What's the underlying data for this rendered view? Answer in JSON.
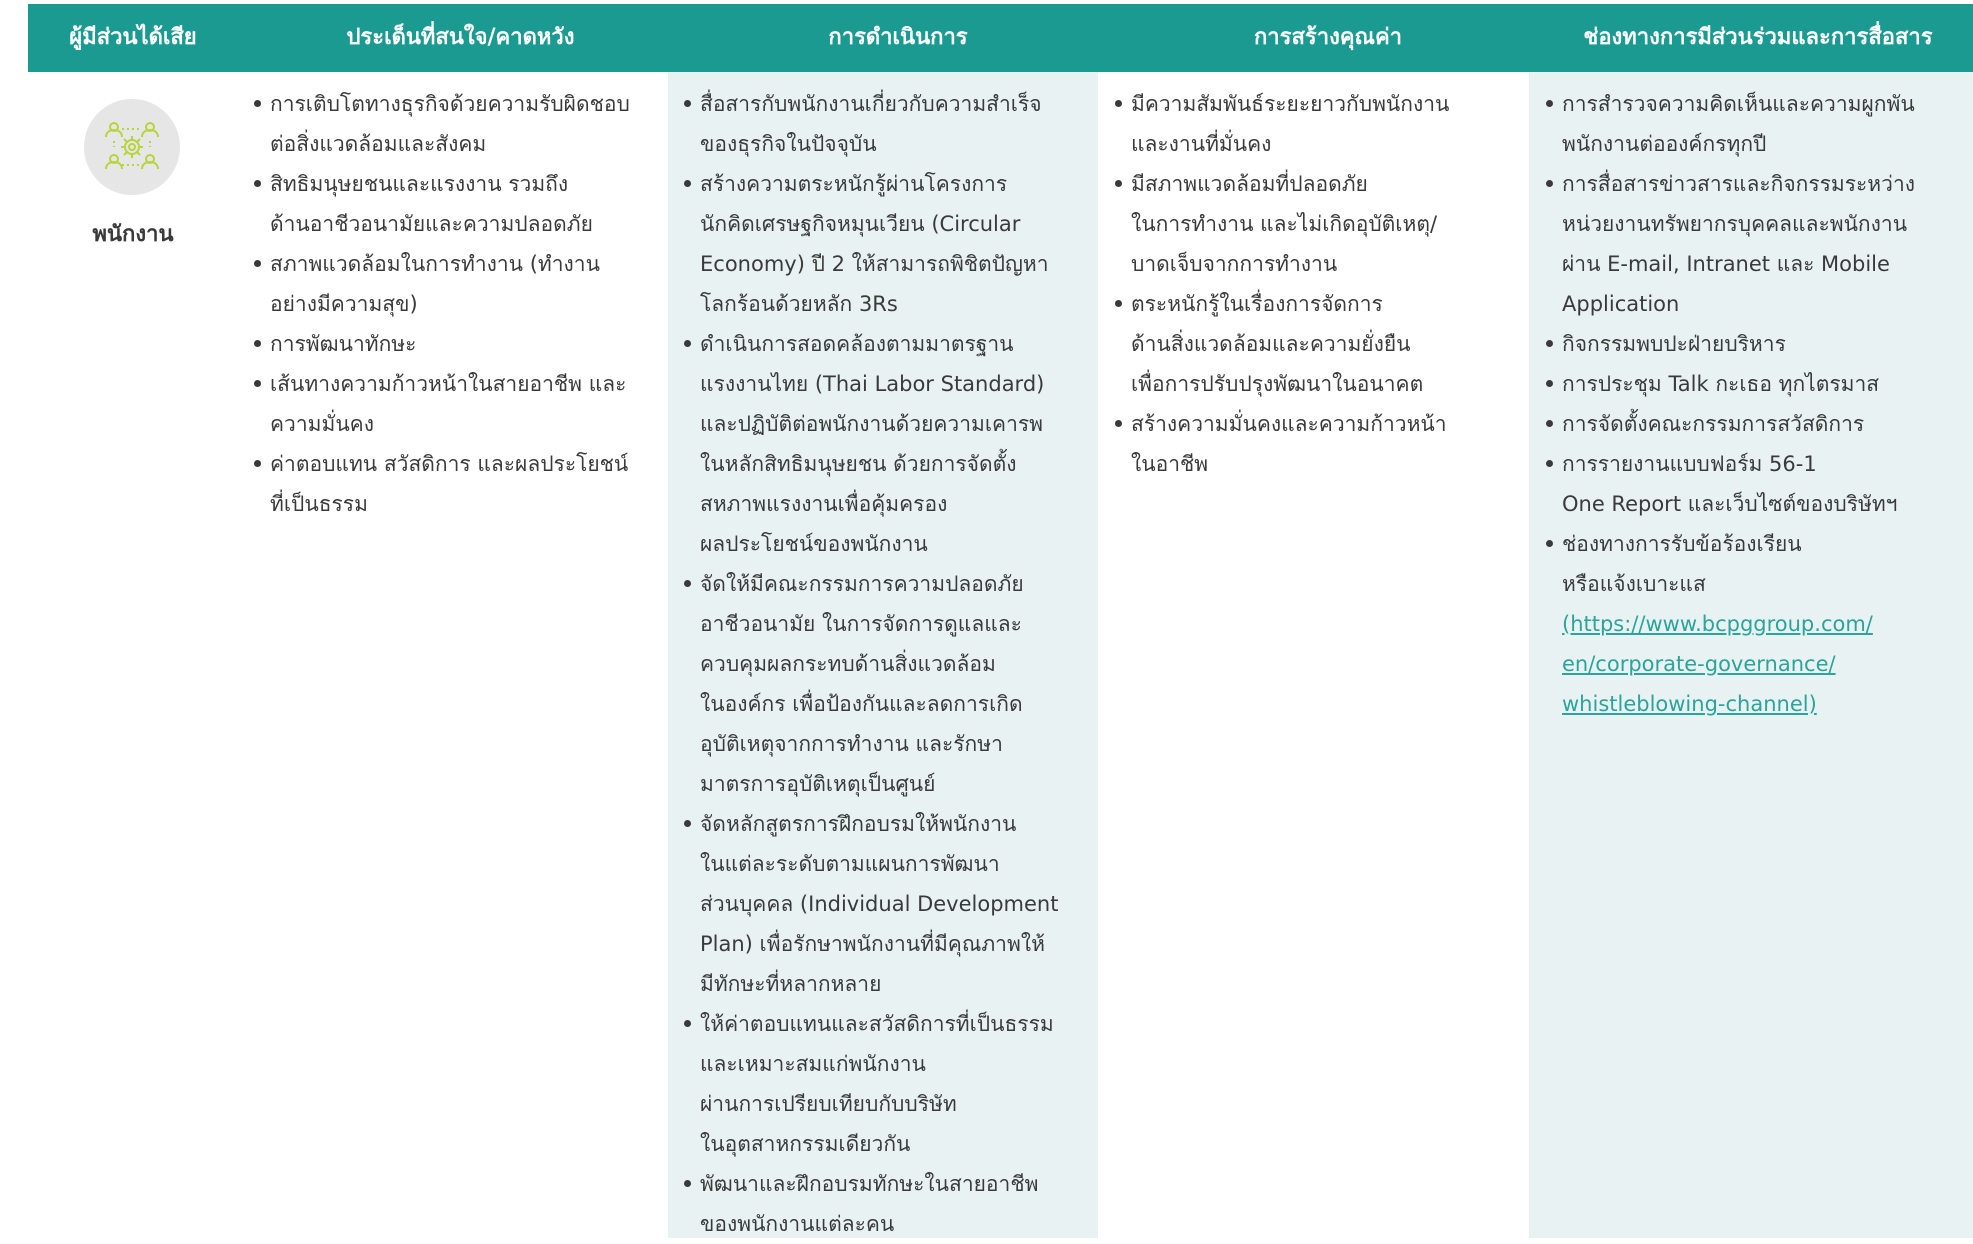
{
  "headers": [
    "ผู้มีส่วนได้เสีย",
    "ประเด็นที่สนใจ/คาดหวัง",
    "การดำเนินการ",
    "การสร้างคุณค่า",
    "ช่องทางการมีส่วนร่วมและการสื่อสาร"
  ],
  "stakeholder": {
    "name": "พนักงาน",
    "icon": "people-network-gear-icon"
  },
  "concerns": [
    [
      "การเติบโตทางธุรกิจด้วยความรับผิดชอบ",
      "ต่อสิ่งแวดล้อมและสังคม"
    ],
    [
      "สิทธิมนุษยชนและแรงงาน รวมถึง",
      "ด้านอาชีวอนามัยและความปลอดภัย"
    ],
    [
      "สภาพแวดล้อมในการทำงาน (ทำงาน",
      "อย่างมีความสุข)"
    ],
    [
      "การพัฒนาทักษะ"
    ],
    [
      "เส้นทางความก้าวหน้าในสายอาชีพ และ",
      "ความมั่นคง"
    ],
    [
      "ค่าตอบแทน สวัสดิการ และผลประโยชน์",
      "ที่เป็นธรรม"
    ]
  ],
  "actions": [
    [
      "สื่อสารกับพนักงานเกี่ยวกับความสำเร็จ",
      "ของธุรกิจในปัจจุบัน"
    ],
    [
      "สร้างความตระหนักรู้ผ่านโครงการ",
      "นักคิดเศรษฐกิจหมุนเวียน (Circular",
      "Economy) ปี 2 ให้สามารถพิชิตปัญหา",
      "โลกร้อนด้วยหลัก 3Rs"
    ],
    [
      "ดำเนินการสอดคล้องตามมาตรฐาน",
      "แรงงานไทย (Thai Labor Standard)",
      "และปฏิบัติต่อพนักงานด้วยความเคารพ",
      "ในหลักสิทธิมนุษยชน ด้วยการจัดตั้ง",
      "สหภาพแรงงานเพื่อคุ้มครอง",
      "ผลประโยชน์ของพนักงาน"
    ],
    [
      "จัดให้มีคณะกรรมการความปลอดภัย",
      "อาชีวอนามัย ในการจัดการดูแลและ",
      "ควบคุมผลกระทบด้านสิ่งแวดล้อม",
      "ในองค์กร เพื่อป้องกันและลดการเกิด",
      "อุบัติเหตุจากการทำงาน และรักษา",
      "มาตรการอุบัติเหตุเป็นศูนย์"
    ],
    [
      "จัดหลักสูตรการฝึกอบรมให้พนักงาน",
      "ในแต่ละระดับตามแผนการพัฒนา",
      "ส่วนบุคคล (Individual Development",
      "Plan) เพื่อรักษาพนักงานที่มีคุณภาพให้",
      "มีทักษะที่หลากหลาย"
    ],
    [
      "ให้ค่าตอบแทนและสวัสดิการที่เป็นธรรม",
      "และเหมาะสมแก่พนักงาน",
      "ผ่านการเปรียบเทียบกับบริษัท",
      "ในอุตสาหกรรมเดียวกัน"
    ],
    [
      "พัฒนาและฝึกอบรมทักษะในสายอาชีพ",
      "ของพนักงานแต่ละคน"
    ]
  ],
  "values": [
    [
      "มีความสัมพันธ์ระยะยาวกับพนักงาน",
      "และงานที่มั่นคง"
    ],
    [
      "มีสภาพแวดล้อมที่ปลอดภัย",
      "ในการทำงาน และไม่เกิดอุบัติเหตุ/",
      "บาดเจ็บจากการทำงาน"
    ],
    [
      "ตระหนักรู้ในเรื่องการจัดการ",
      "ด้านสิ่งแวดล้อมและความยั่งยืน",
      "เพื่อการปรับปรุงพัฒนาในอนาคต"
    ],
    [
      "สร้างความมั่นคงและความก้าวหน้า",
      "ในอาชีพ"
    ]
  ],
  "channels": [
    [
      "การสำรวจความคิดเห็นและความผูกพัน",
      "พนักงานต่อองค์กรทุกปี"
    ],
    [
      "การสื่อสารข่าวสารและกิจกรรมระหว่าง",
      "หน่วยงานทรัพยากรบุคคลและพนักงาน",
      "ผ่าน E-mail, Intranet และ Mobile",
      "Application"
    ],
    [
      "กิจกรรมพบปะฝ่ายบริหาร"
    ],
    [
      "การประชุม Talk กะเธอ ทุกไตรมาส"
    ],
    [
      "การจัดตั้งคณะกรรมการสวัสดิการ"
    ],
    [
      "การรายงานแบบฟอร์ม 56-1",
      "One Report และเว็บไซต์ของบริษัทฯ"
    ],
    [
      "ช่องทางการรับข้อร้องเรียน",
      "หรือแจ้งเบาะแส"
    ]
  ],
  "whistleblowing_link": [
    "(https://www.bcpggroup.com/",
    "en/corporate-governance/",
    "whistleblowing-channel)"
  ],
  "colors": {
    "header_bg": "#1a9a91",
    "column_shade": "#e9f2f2",
    "icon_stroke": "#b7d43a",
    "icon_bg": "#e6e6e6",
    "link": "#2ba49b"
  }
}
